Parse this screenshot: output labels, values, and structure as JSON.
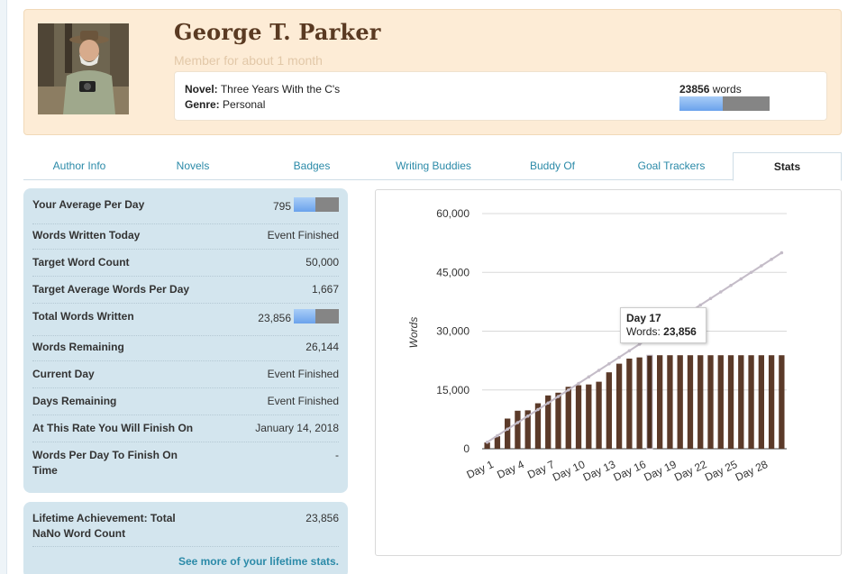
{
  "profile": {
    "name": "George T. Parker",
    "member_since": "Member for about 1 month",
    "novel_label": "Novel:",
    "novel_title": "Three Years With the C's",
    "genre_label": "Genre:",
    "genre": "Personal",
    "word_count": "23856",
    "word_count_unit": "words",
    "progress_fraction": 0.477
  },
  "tabs": [
    {
      "label": "Author Info"
    },
    {
      "label": "Novels"
    },
    {
      "label": "Badges"
    },
    {
      "label": "Writing Buddies"
    },
    {
      "label": "Buddy Of"
    },
    {
      "label": "Goal Trackers"
    },
    {
      "label": "Stats",
      "active": true
    }
  ],
  "stats": [
    {
      "label": "Your Average Per Day",
      "value": "795",
      "bar_fraction": 0.477
    },
    {
      "label": "Words Written Today",
      "value": "Event Finished"
    },
    {
      "label": "Target Word Count",
      "value": "50,000"
    },
    {
      "label": "Target Average Words Per Day",
      "value": "1,667"
    },
    {
      "label": "Total Words Written",
      "value": "23,856",
      "bar_fraction": 0.477
    },
    {
      "label": "Words Remaining",
      "value": "26,144"
    },
    {
      "label": "Current Day",
      "value": "Event Finished"
    },
    {
      "label": "Days Remaining",
      "value": "Event Finished"
    },
    {
      "label": "At This Rate You Will Finish On",
      "value": "January 14, 2018"
    },
    {
      "label": "Words Per Day To Finish On Time",
      "value": "-"
    }
  ],
  "lifetime": {
    "label": "Lifetime Achievement: Total NaNo Word Count",
    "value": "23,856",
    "link": "See more of your lifetime stats."
  },
  "colors": {
    "bar": "#5b3a29",
    "target_line": "#c4bcc8",
    "progress_fill": "#7fb0f0",
    "progress_bg": "#858585",
    "panel_bg": "#d3e5ee",
    "header_bg": "#fdecd6",
    "link": "#2b8aa8"
  },
  "chart_data": {
    "type": "bar",
    "ylabel": "Words",
    "ylim": [
      0,
      60000
    ],
    "yticks": [
      "0",
      "15,000",
      "30,000",
      "45,000",
      "60,000"
    ],
    "ytick_values": [
      0,
      15000,
      30000,
      45000,
      60000
    ],
    "x_tick_labels": [
      "Day 1",
      "Day 4",
      "Day 7",
      "Day 10",
      "Day 13",
      "Day 16",
      "Day 19",
      "Day 22",
      "Day 25",
      "Day 28"
    ],
    "categories": [
      "Day 1",
      "Day 2",
      "Day 3",
      "Day 4",
      "Day 5",
      "Day 6",
      "Day 7",
      "Day 8",
      "Day 9",
      "Day 10",
      "Day 11",
      "Day 12",
      "Day 13",
      "Day 14",
      "Day 15",
      "Day 16",
      "Day 17",
      "Day 18",
      "Day 19",
      "Day 20",
      "Day 21",
      "Day 22",
      "Day 23",
      "Day 24",
      "Day 25",
      "Day 26",
      "Day 27",
      "Day 28",
      "Day 29",
      "Day 30"
    ],
    "series": [
      {
        "values": [
          1600,
          3200,
          7700,
          9700,
          9800,
          11600,
          13600,
          14300,
          15800,
          16200,
          16400,
          17100,
          19500,
          21700,
          23000,
          23300,
          23856,
          23856,
          23856,
          23856,
          23856,
          23856,
          23856,
          23856,
          23856,
          23856,
          23856,
          23856,
          23856,
          23856
        ]
      },
      {
        "values": [
          1667,
          3333,
          5000,
          6667,
          8333,
          10000,
          11667,
          13333,
          15000,
          16667,
          18333,
          20000,
          21667,
          23333,
          25000,
          26667,
          28333,
          30000,
          31667,
          33333,
          35000,
          36667,
          38333,
          40000,
          41667,
          43333,
          45000,
          46667,
          48333,
          50000
        ]
      }
    ],
    "tooltip": {
      "title": "Day 17",
      "label": "Words:",
      "value": "23,856",
      "index": 16
    },
    "grid": true
  }
}
